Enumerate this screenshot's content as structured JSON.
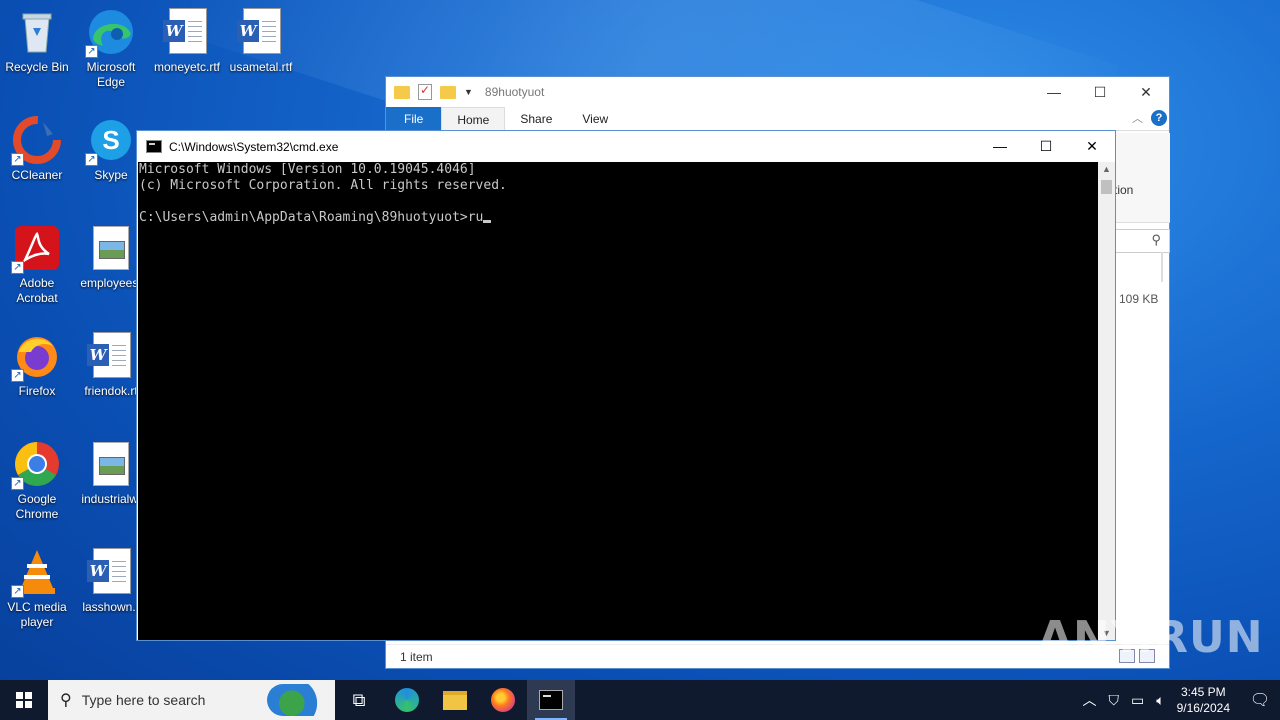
{
  "desktop": {
    "icons": [
      {
        "label": "Recycle Bin"
      },
      {
        "label": "Microsoft Edge"
      },
      {
        "label": "moneyetc.rtf"
      },
      {
        "label": "usametal.rtf"
      },
      {
        "label": "CCleaner"
      },
      {
        "label": "Skype"
      },
      {
        "label": "Adobe Acrobat"
      },
      {
        "label": "employees."
      },
      {
        "label": "Firefox"
      },
      {
        "label": "friendok.rt"
      },
      {
        "label": "Google Chrome"
      },
      {
        "label": "industrialwi"
      },
      {
        "label": "VLC media player"
      },
      {
        "label": "lasshown.r"
      }
    ]
  },
  "explorer": {
    "title": "89huotyuot",
    "tabs": [
      "File",
      "Home",
      "Share",
      "View"
    ],
    "side_text": "tion",
    "file_size": "109 KB",
    "status": "1 item"
  },
  "cmd": {
    "title": "C:\\Windows\\System32\\cmd.exe",
    "lines": [
      "Microsoft Windows [Version 10.0.19045.4046]",
      "(c) Microsoft Corporation. All rights reserved.",
      "",
      "C:\\Users\\admin\\AppData\\Roaming\\89huotyuot>ru"
    ]
  },
  "watermark": "ANY.RUN",
  "taskbar": {
    "search_placeholder": "Type here to search",
    "time": "3:45 PM",
    "date": "9/16/2024"
  }
}
